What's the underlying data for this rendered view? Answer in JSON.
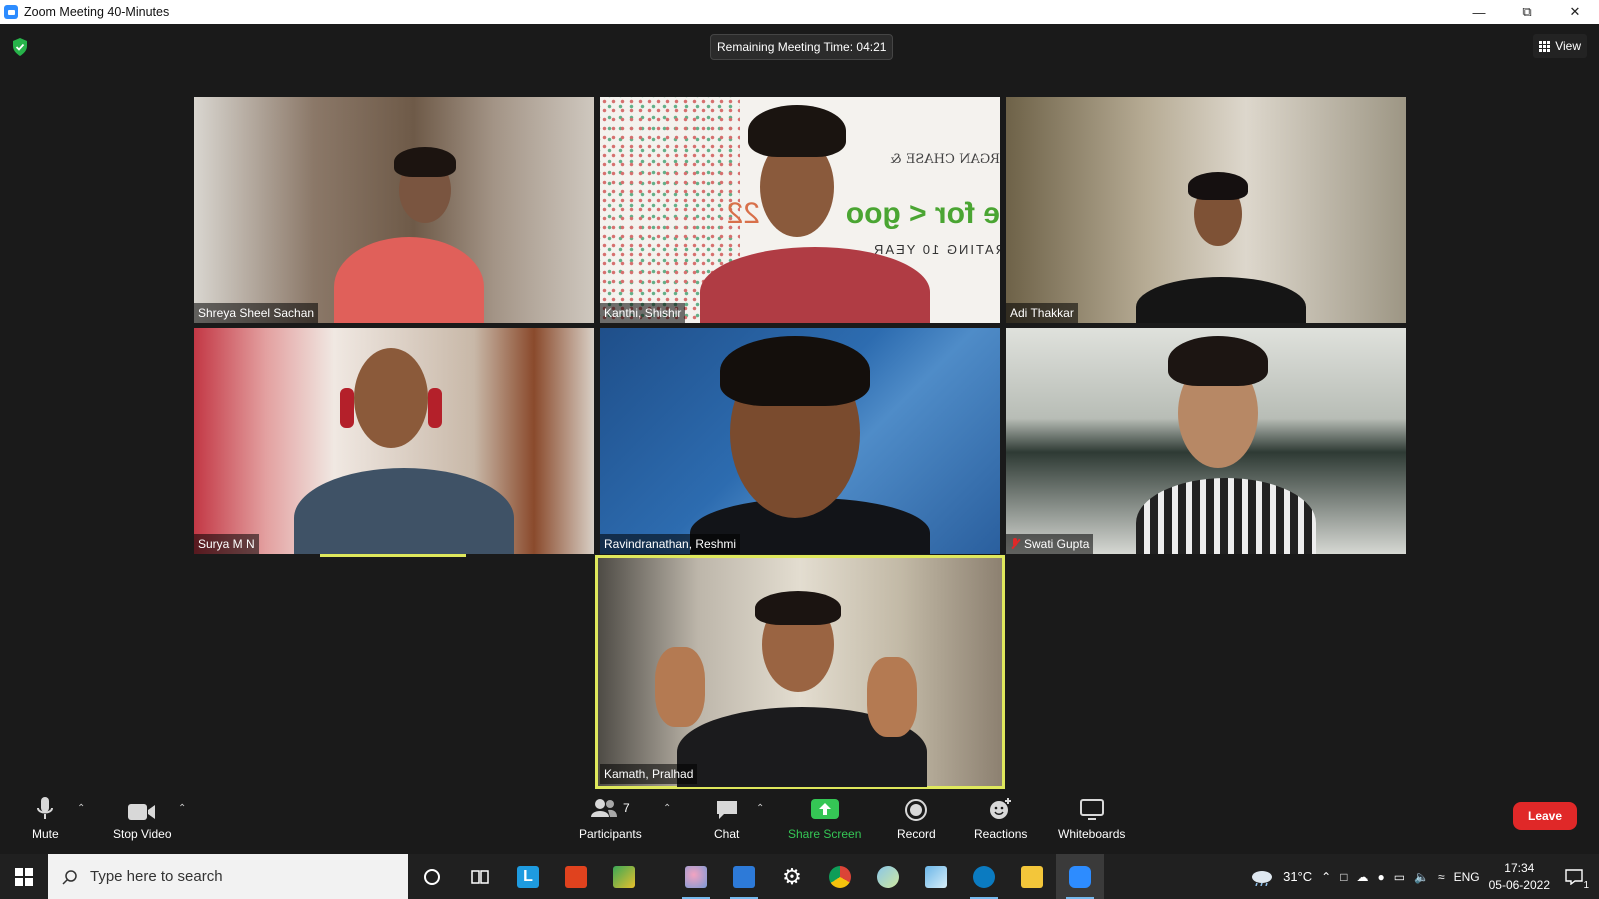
{
  "window": {
    "title": "Zoom Meeting 40-Minutes"
  },
  "meeting": {
    "timer_text": "Remaining Meeting Time: 04:21",
    "view_label": "View",
    "participants": [
      {
        "name": "Shreya Sheel Sachan",
        "muted": false
      },
      {
        "name": "Kanthi, Shishir",
        "muted": false
      },
      {
        "name": "Adi Thakkar",
        "muted": false
      },
      {
        "name": "Surya M N",
        "muted": false
      },
      {
        "name": "Ravindranathan, Reshmi",
        "muted": false
      },
      {
        "name": "Swati Gupta",
        "muted": true
      },
      {
        "name": "Kamath, Pralhad",
        "muted": false,
        "active_speaker": true
      }
    ],
    "backdrop_text": {
      "line1": "RGAN CHASE &",
      "line2": "e for < goo",
      "line3": "RATING 10 YEAR",
      "year": "22"
    }
  },
  "toolbar": {
    "mute_label": "Mute",
    "stop_video_label": "Stop Video",
    "participants_label": "Participants",
    "participants_count": "7",
    "chat_label": "Chat",
    "share_screen_label": "Share Screen",
    "record_label": "Record",
    "reactions_label": "Reactions",
    "whiteboards_label": "Whiteboards",
    "leave_label": "Leave"
  },
  "taskbar": {
    "search_placeholder": "Type here to search",
    "weather": "31°C",
    "language": "ENG",
    "time": "17:34",
    "date": "05-06-2022",
    "notification_count": "1"
  },
  "colors": {
    "accent": "#2d8cff",
    "share_green": "#35c655",
    "leave_red": "#e02828",
    "speaker_highlight": "#dfe85c"
  }
}
